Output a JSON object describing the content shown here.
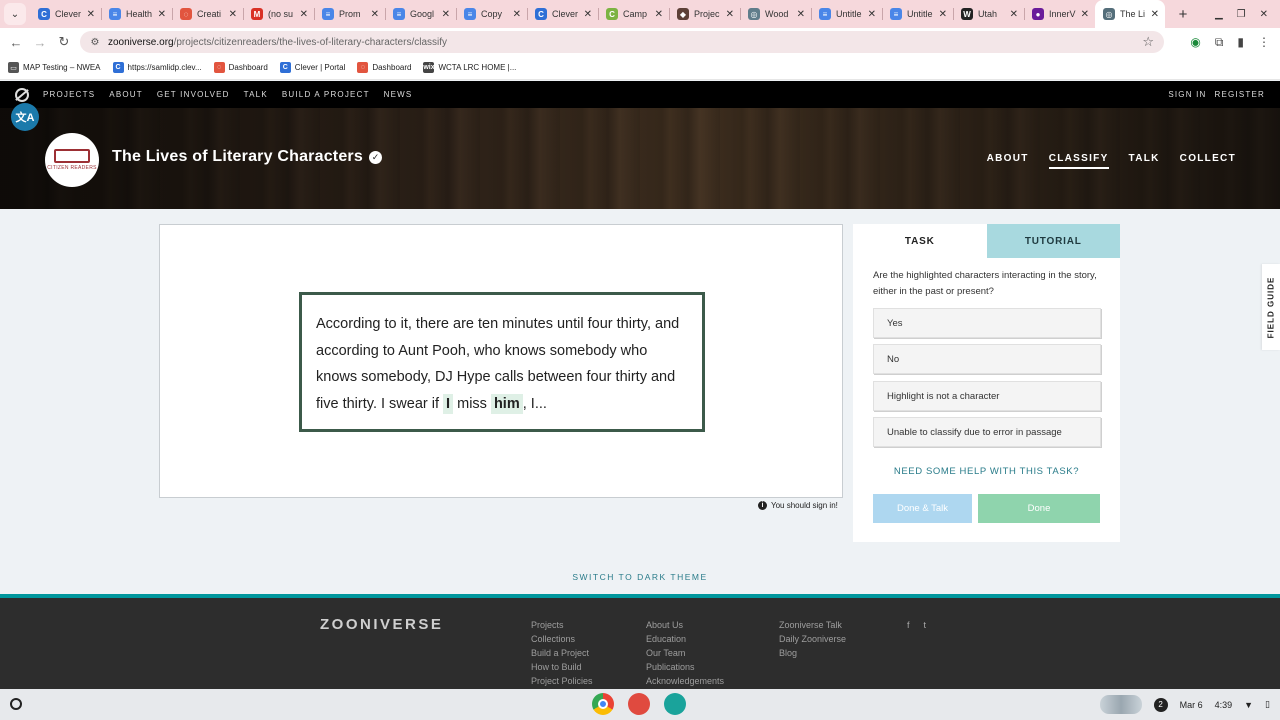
{
  "browser": {
    "tabs": [
      {
        "title": "Clever",
        "color": "#2f6fd6",
        "glyph": "C"
      },
      {
        "title": "Health",
        "color": "#4a86e8",
        "glyph": "≡"
      },
      {
        "title": "Creati",
        "color": "#e2553f",
        "glyph": "◌"
      },
      {
        "title": "(no su",
        "color": "#d93025",
        "glyph": "M"
      },
      {
        "title": "Prom",
        "color": "#4a86e8",
        "glyph": "≡"
      },
      {
        "title": "Googl",
        "color": "#4a86e8",
        "glyph": "≡"
      },
      {
        "title": "Copy",
        "color": "#4a86e8",
        "glyph": "≡"
      },
      {
        "title": "Clever",
        "color": "#2f6fd6",
        "glyph": "C"
      },
      {
        "title": "Camp",
        "color": "#7cb342",
        "glyph": "C"
      },
      {
        "title": "Projec",
        "color": "#5d4037",
        "glyph": "◆"
      },
      {
        "title": "Wood",
        "color": "#607d8b",
        "glyph": "◎"
      },
      {
        "title": "Untitle",
        "color": "#4a86e8",
        "glyph": "≡"
      },
      {
        "title": "Untitle",
        "color": "#4a86e8",
        "glyph": "≡"
      },
      {
        "title": "Utah",
        "color": "#222222",
        "glyph": "W"
      },
      {
        "title": "InnerV",
        "color": "#6a1b9a",
        "glyph": "●"
      },
      {
        "title": "The Li",
        "color": "#546e7a",
        "glyph": "◎"
      }
    ],
    "active_tab_index": 15,
    "url_host": "zooniverse.org",
    "url_path": "/projects/citizenreaders/the-lives-of-literary-characters/classify",
    "bookmarks": [
      {
        "label": "MAP Testing – NWEA",
        "color": "#555555",
        "glyph": "▭"
      },
      {
        "label": "https://samlidp.clev...",
        "color": "#2f6fd6",
        "glyph": "C"
      },
      {
        "label": "Dashboard",
        "color": "#e2553f",
        "glyph": "◌"
      },
      {
        "label": "Clever | Portal",
        "color": "#2f6fd6",
        "glyph": "C"
      },
      {
        "label": "Dashboard",
        "color": "#e2553f",
        "glyph": "◌"
      },
      {
        "label": "WCTA LRC HOME |...",
        "color": "#444444",
        "glyph": "wix"
      }
    ]
  },
  "zooniverse": {
    "nav": [
      "PROJECTS",
      "ABOUT",
      "GET INVOLVED",
      "TALK",
      "BUILD A PROJECT",
      "NEWS"
    ],
    "sign_in": "SIGN IN",
    "register": "REGISTER"
  },
  "project": {
    "title": "The Lives of Literary Characters",
    "logo_text": "CITIZEN READERS",
    "nav": [
      "ABOUT",
      "CLASSIFY",
      "TALK",
      "COLLECT"
    ],
    "active_nav": "CLASSIFY"
  },
  "passage": {
    "text_before": "According to it, there are ten minutes until four thirty, and according to Aunt Pooh, who knows somebody who knows somebody, DJ Hype calls between four thirty and five thirty. I swear if",
    "highlight_1": "I",
    "text_middle": "miss",
    "highlight_2": "him",
    "text_after": ", I..."
  },
  "signin_note": "You should sign in!",
  "task": {
    "tab_task": "TASK",
    "tab_tutorial": "TUTORIAL",
    "question": "Are the highlighted characters interacting in the story, either in the past or present?",
    "answers": [
      "Yes",
      "No",
      "Highlight is not a character",
      "Unable to classify due to error in passage"
    ],
    "help": "NEED SOME HELP WITH THIS TASK?",
    "done_talk": "Done & Talk",
    "done": "Done"
  },
  "field_guide": "FIELD GUIDE",
  "dark_theme": "SWITCH TO DARK THEME",
  "footer": {
    "logo": "ZOONIVERSE",
    "col1": [
      "Projects",
      "Collections",
      "Build a Project",
      "How to Build",
      "Project Policies"
    ],
    "col2": [
      "About Us",
      "Education",
      "Our Team",
      "Publications",
      "Acknowledgements"
    ],
    "col3": [
      "Zooniverse Talk",
      "Daily Zooniverse",
      "Blog"
    ],
    "social": [
      "f",
      "t"
    ]
  },
  "shelf": {
    "notifications": "2",
    "date": "Mar 6",
    "time": "4:39"
  },
  "colors": {
    "accent_teal": "#00979d",
    "highlight": "#dff0e6",
    "tutorial_tab": "#a8d9df",
    "done_button": "#8fd4ad",
    "done_talk_button": "#aed7f0"
  }
}
